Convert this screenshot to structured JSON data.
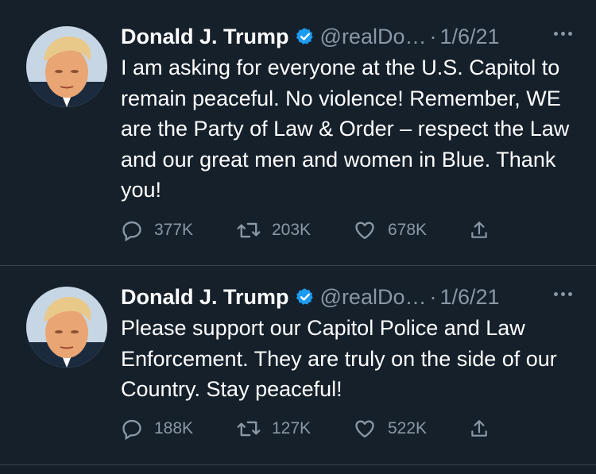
{
  "tweets": [
    {
      "author": "Donald J. Trump",
      "handle": "@realDo…",
      "separator": "·",
      "date": "1/6/21",
      "text": "I am asking for everyone at the U.S. Capitol to remain peaceful. No violence! Remember, WE are the Party of Law & Order – respect the Law and our great men and women in Blue. Thank you!",
      "replies": "377K",
      "retweets": "203K",
      "likes": "678K"
    },
    {
      "author": "Donald J. Trump",
      "handle": "@realDo…",
      "separator": "·",
      "date": "1/6/21",
      "text": "Please support our Capitol Police and Law Enforcement. They are truly on the side of our Country. Stay peaceful!",
      "replies": "188K",
      "retweets": "127K",
      "likes": "522K"
    }
  ],
  "icons": {
    "verified": "verified-badge-icon",
    "more": "more-options-icon",
    "reply": "reply-icon",
    "retweet": "retweet-icon",
    "like": "like-icon",
    "share": "share-icon"
  },
  "colors": {
    "background": "#15202b",
    "muted": "#8b98a5",
    "verified": "#1d9bf0",
    "divider": "#38444d"
  }
}
